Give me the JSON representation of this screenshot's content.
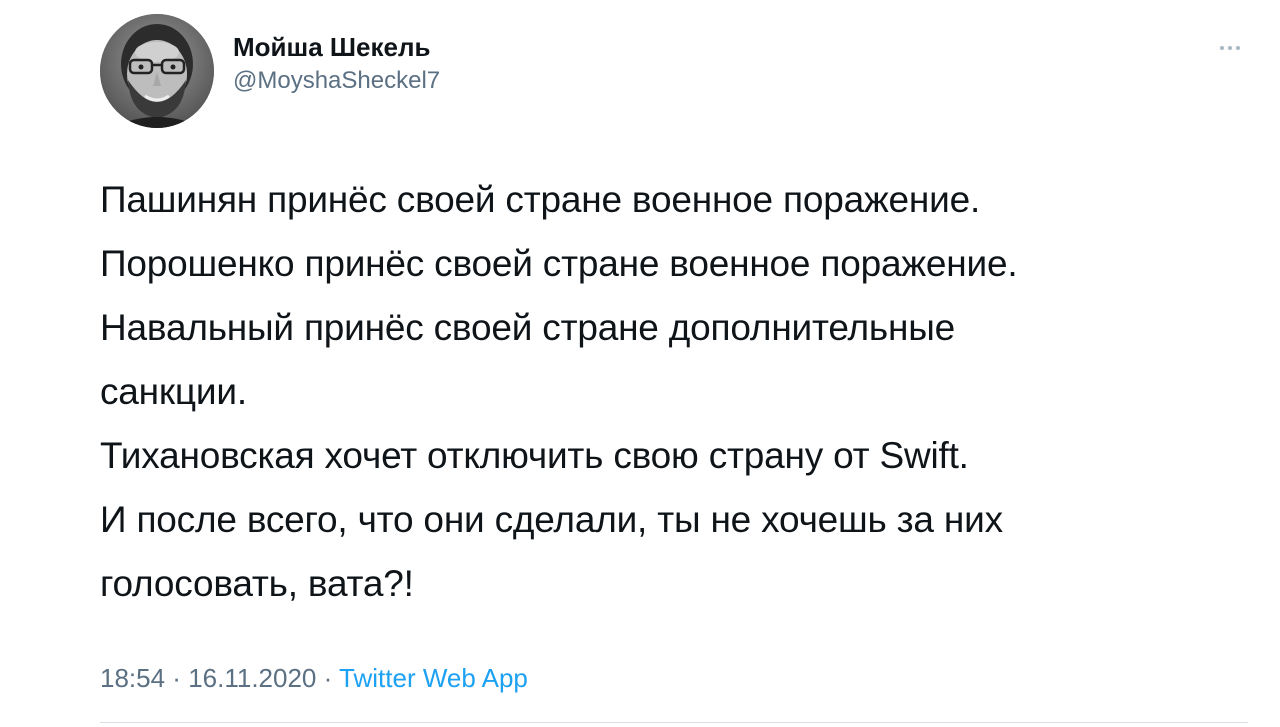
{
  "author": {
    "display_name": "Мойша Шекель",
    "handle": "@MoyshaSheckel7",
    "avatar_icon": "user-avatar-photo"
  },
  "more_menu_icon": "more-options-icon",
  "tweet": {
    "lines": [
      "Пашинян принёс своей стране военное поражение.",
      "Порошенко принёс своей стране военное поражение.",
      "Навальный принёс своей стране дополнительные",
      "санкции.",
      "Тихановская хочет отключить свою страну от Swift.",
      "И после всего, что они сделали, ты не хочешь за них",
      "голосовать, вата?!"
    ]
  },
  "meta": {
    "time": "18:54",
    "separator": " · ",
    "date": "16.11.2020",
    "source": "Twitter Web App"
  },
  "colors": {
    "text": "#0f1419",
    "secondary": "#5b7083",
    "link": "#1da1f2"
  }
}
